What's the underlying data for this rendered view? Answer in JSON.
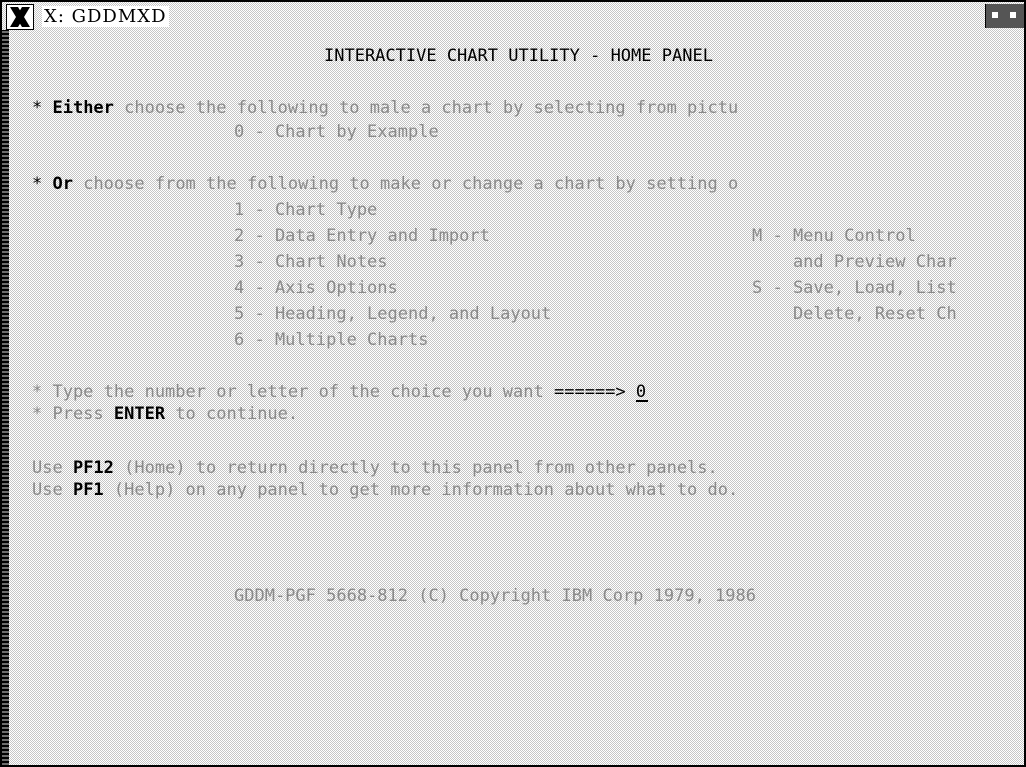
{
  "window": {
    "title": "X: GDDMXD"
  },
  "panel": {
    "title": "INTERACTIVE CHART UTILITY - HOME PANEL",
    "either": {
      "bullet": "* ",
      "keyword": "Either",
      "text": " choose the following to male a chart by selecting from pictu",
      "option": "0 - Chart by Example"
    },
    "or": {
      "bullet": "* ",
      "keyword": "Or",
      "text": " choose from the following to make or change a chart by setting o"
    },
    "options_left": [
      "1 - Chart Type",
      "2 - Data Entry and Import",
      "3 - Chart Notes",
      "4 - Axis Options",
      "5 - Heading, Legend, and Layout",
      "6 - Multiple Charts"
    ],
    "options_right": [
      "M - Menu Control",
      "    and Preview Char",
      "S - Save, Load, List",
      "    Delete, Reset Ch"
    ],
    "prompt": {
      "text": "* Type the number or letter of the choice you want ",
      "arrow": "======>",
      "value": "0"
    },
    "enter": {
      "pre": "* Press ",
      "key": "ENTER",
      "post": " to continue."
    },
    "help_lines": [
      {
        "pre": "Use ",
        "key": "PF12",
        "post": " (Home) to return directly to this panel from other panels."
      },
      {
        "pre": "Use ",
        "key": "PF1",
        "post": " (Help) on any panel to get more information about what to do."
      }
    ],
    "copyright": "GDDM-PGF 5668-812 (C) Copyright IBM Corp 1979, 1986"
  }
}
